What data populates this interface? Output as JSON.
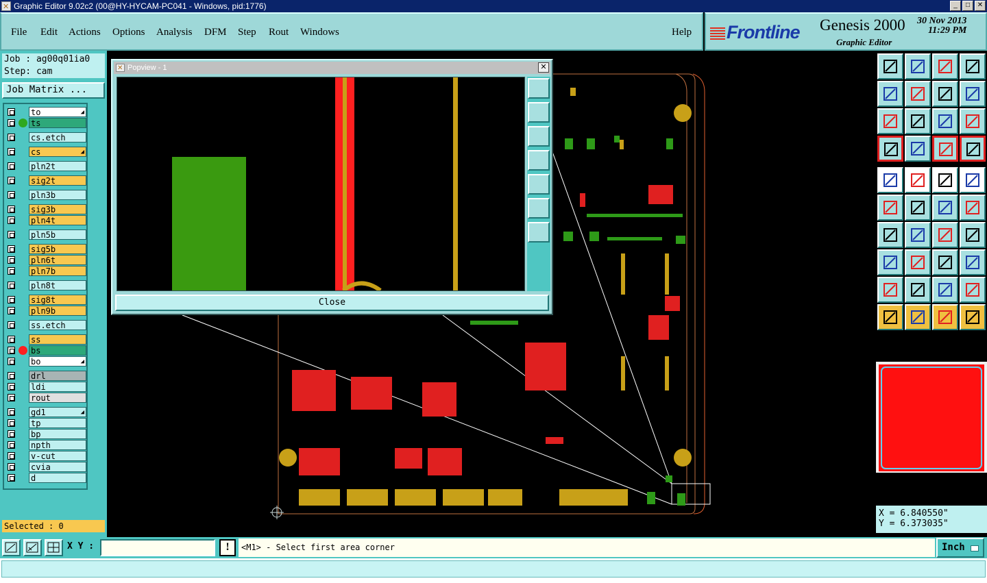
{
  "window": {
    "title": "Graphic Editor 9.02c2 (00@HY-HYCAM-PC041 - Windows, pid:1776)"
  },
  "menu": {
    "items": [
      {
        "label": "File"
      },
      {
        "label": "Edit"
      },
      {
        "label": "Actions"
      },
      {
        "label": "Options"
      },
      {
        "label": "Analysis"
      },
      {
        "label": "DFM"
      },
      {
        "label": "Step"
      },
      {
        "label": "Rout"
      },
      {
        "label": "Windows"
      }
    ],
    "help": "Help"
  },
  "branding": {
    "logo": "Frontline",
    "product": "Genesis 2000",
    "subtitle": "Graphic Editor",
    "date": "30 Nov 2013",
    "time": "11:29 PM"
  },
  "job": {
    "job_line": "Job : ag00q01ia0",
    "step_line": "Step: cam",
    "matrix_button": "Job Matrix ..."
  },
  "layers": [
    {
      "name": "to",
      "bg": "#ffffff",
      "arrow": true,
      "dot": null
    },
    {
      "name": "ts",
      "bg": "#2ea87a",
      "arrow": false,
      "dot": "#2ea820"
    },
    {
      "name": "cs.etch",
      "bg": "#bff0f0",
      "arrow": false,
      "dot": null
    },
    {
      "name": "cs",
      "bg": "#f8c850",
      "arrow": true,
      "dot": null
    },
    {
      "name": "pln2t",
      "bg": "#bff0f0",
      "arrow": false,
      "dot": null
    },
    {
      "name": "sig2t",
      "bg": "#f8c850",
      "arrow": false,
      "dot": null
    },
    {
      "name": "pln3b",
      "bg": "#bff0f0",
      "arrow": false,
      "dot": null
    },
    {
      "name": "sig3b",
      "bg": "#f8c850",
      "arrow": false,
      "dot": null
    },
    {
      "name": "pln4t",
      "bg": "#f8c850",
      "arrow": false,
      "dot": null
    },
    {
      "name": "pln5b",
      "bg": "#bff0f0",
      "arrow": false,
      "dot": null
    },
    {
      "name": "sig5b",
      "bg": "#f8c850",
      "arrow": false,
      "dot": null
    },
    {
      "name": "pln6t",
      "bg": "#f8c850",
      "arrow": false,
      "dot": null
    },
    {
      "name": "pln7b",
      "bg": "#f8c850",
      "arrow": false,
      "dot": null
    },
    {
      "name": "pln8t",
      "bg": "#bff0f0",
      "arrow": false,
      "dot": null
    },
    {
      "name": "sig8t",
      "bg": "#f8c850",
      "arrow": false,
      "dot": null
    },
    {
      "name": "pln9b",
      "bg": "#f8c850",
      "arrow": false,
      "dot": null
    },
    {
      "name": "ss.etch",
      "bg": "#bff0f0",
      "arrow": false,
      "dot": null
    },
    {
      "name": "ss",
      "bg": "#f8c850",
      "arrow": false,
      "dot": null
    },
    {
      "name": "bs",
      "bg": "#2ea87a",
      "arrow": false,
      "dot": "#ff2020"
    },
    {
      "name": "bo",
      "bg": "#ffffff",
      "arrow": true,
      "dot": null
    },
    {
      "name": "drl",
      "bg": "#a8b4b4",
      "arrow": false,
      "dot": null
    },
    {
      "name": "ldi",
      "bg": "#bff0f0",
      "arrow": false,
      "dot": null
    },
    {
      "name": "rout",
      "bg": "#e0e0e0",
      "arrow": false,
      "dot": null
    },
    {
      "name": "gd1",
      "bg": "#bff0f0",
      "arrow": true,
      "dot": null
    },
    {
      "name": "tp",
      "bg": "#bff0f0",
      "arrow": false,
      "dot": null
    },
    {
      "name": "bp",
      "bg": "#bff0f0",
      "arrow": false,
      "dot": null
    },
    {
      "name": "npth",
      "bg": "#bff0f0",
      "arrow": false,
      "dot": null
    },
    {
      "name": "v-cut",
      "bg": "#bff0f0",
      "arrow": false,
      "dot": null
    },
    {
      "name": "cvia",
      "bg": "#bff0f0",
      "arrow": false,
      "dot": null
    },
    {
      "name": "d",
      "bg": "#bff0f0",
      "arrow": false,
      "dot": null
    }
  ],
  "selected": "Selected : 0",
  "popview": {
    "title": "Popview - 1",
    "close_label": "Close"
  },
  "coords": {
    "x": "X = 6.840550\"",
    "y": "Y = 6.373035\""
  },
  "status": {
    "xy_label": "X Y :",
    "xy_value": "",
    "prompt": "<M1> - Select first area corner",
    "unit": "Inch"
  },
  "colors": {
    "panel": "#4fc6c2",
    "light": "#bff0f0",
    "copper_green": "#2e9a18",
    "pad_gold": "#c8a018",
    "red": "#ff2020"
  }
}
